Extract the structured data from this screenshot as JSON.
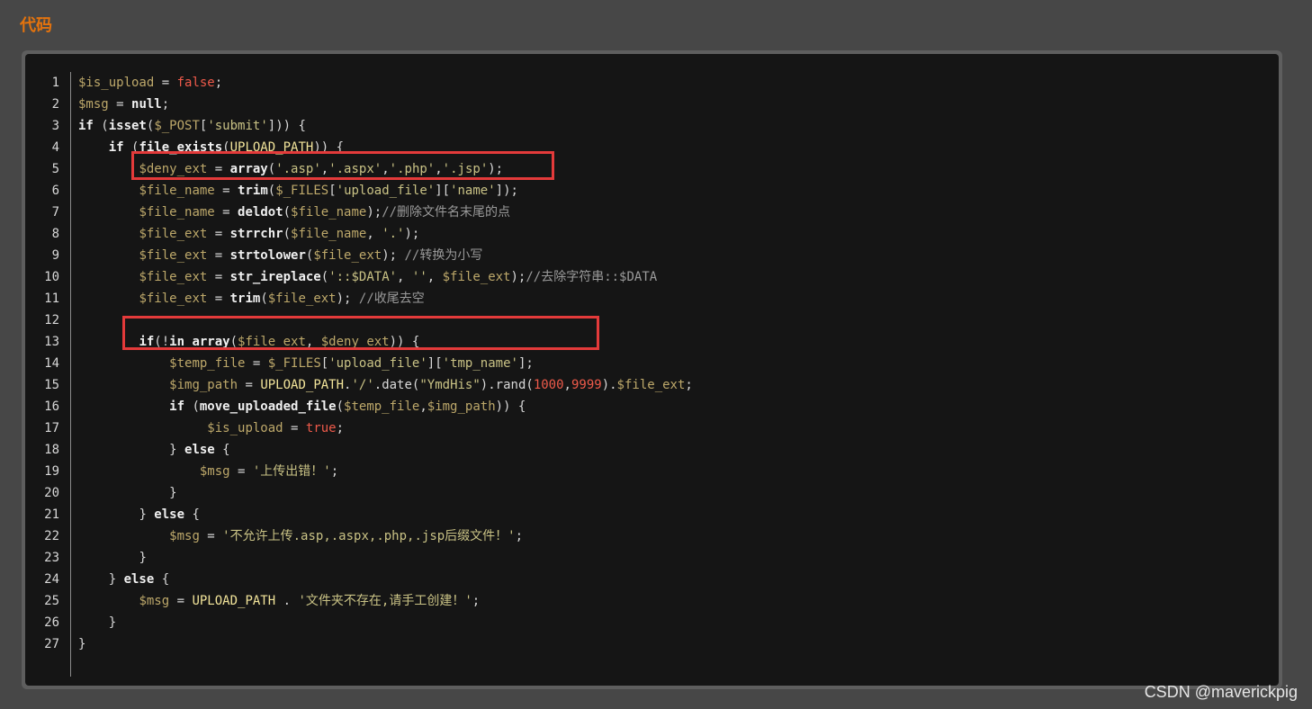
{
  "section_title": "代码",
  "watermark": "CSDN @maverickpig",
  "colors": {
    "page_bg": "#474747",
    "code_bg": "#151515",
    "title": "#e4730d",
    "highlight_box": "#e33a3a"
  },
  "code": {
    "language": "php",
    "line_numbers": [
      "1",
      "2",
      "3",
      "4",
      "5",
      "6",
      "7",
      "8",
      "9",
      "10",
      "11",
      "12",
      "13",
      "14",
      "15",
      "16",
      "17",
      "18",
      "19",
      "20",
      "21",
      "22",
      "23",
      "24",
      "25",
      "26",
      "27"
    ],
    "tokens": {
      "l1": [
        "$is_upload",
        " = ",
        "false",
        ";"
      ],
      "l2": [
        "$msg",
        " = ",
        "null",
        ";"
      ],
      "l3": [
        "if",
        " (",
        "isset",
        "(",
        "$_POST",
        "[",
        "'submit'",
        "])) {"
      ],
      "l4": [
        "    ",
        "if",
        " (",
        "file_exists",
        "(",
        "UPLOAD_PATH",
        ")) {"
      ],
      "l5": [
        "        ",
        "$deny_ext",
        " = ",
        "array",
        "(",
        "'.asp'",
        ",",
        "'.aspx'",
        ",",
        "'.php'",
        ",",
        "'.jsp'",
        ");"
      ],
      "l6": [
        "        ",
        "$file_name",
        " = ",
        "trim",
        "(",
        "$_FILES",
        "[",
        "'upload_file'",
        "][",
        "'name'",
        "]);"
      ],
      "l7": [
        "        ",
        "$file_name",
        " = ",
        "deldot",
        "(",
        "$file_name",
        ");",
        "//删除文件名末尾的点"
      ],
      "l8": [
        "        ",
        "$file_ext",
        " = ",
        "strrchr",
        "(",
        "$file_name",
        ", ",
        "'.'",
        ");"
      ],
      "l9": [
        "        ",
        "$file_ext",
        " = ",
        "strtolower",
        "(",
        "$file_ext",
        "); ",
        "//转换为小写"
      ],
      "l10": [
        "        ",
        "$file_ext",
        " = ",
        "str_ireplace",
        "(",
        "'::$DATA'",
        ", ",
        "''",
        ", ",
        "$file_ext",
        ");",
        "//去除字符串::$DATA"
      ],
      "l11": [
        "        ",
        "$file_ext",
        " = ",
        "trim",
        "(",
        "$file_ext",
        "); ",
        "//收尾去空"
      ],
      "l12": [
        ""
      ],
      "l13": [
        "        ",
        "if",
        "(!",
        "in_array",
        "(",
        "$file_ext",
        ", ",
        "$deny_ext",
        ")) {"
      ],
      "l14": [
        "            ",
        "$temp_file",
        " = ",
        "$_FILES",
        "[",
        "'upload_file'",
        "][",
        "'tmp_name'",
        "];"
      ],
      "l15": [
        "            ",
        "$img_path",
        " = ",
        "UPLOAD_PATH",
        ".",
        "'/'",
        ".",
        "date",
        "(",
        "\"YmdHis\"",
        ").",
        "rand",
        "(",
        "1000",
        ",",
        "9999",
        ").",
        "$file_ext",
        ";"
      ],
      "l16": [
        "            ",
        "if",
        " (",
        "move_uploaded_file",
        "(",
        "$temp_file",
        ",",
        "$img_path",
        ")) {"
      ],
      "l17": [
        "                 ",
        "$is_upload",
        " = ",
        "true",
        ";"
      ],
      "l18": [
        "            ",
        "} ",
        "else",
        " {"
      ],
      "l19": [
        "                ",
        "$msg",
        " = ",
        "'上传出错！'",
        ";"
      ],
      "l20": [
        "            ",
        "}"
      ],
      "l21": [
        "        ",
        "} ",
        "else",
        " {"
      ],
      "l22": [
        "            ",
        "$msg",
        " = ",
        "'不允许上传.asp,.aspx,.php,.jsp后缀文件！'",
        ";"
      ],
      "l23": [
        "        ",
        "}"
      ],
      "l24": [
        "    ",
        "} ",
        "else",
        " {"
      ],
      "l25": [
        "        ",
        "$msg",
        " = ",
        "UPLOAD_PATH",
        " . ",
        "'文件夹不存在,请手工创建！'",
        ";"
      ],
      "l26": [
        "    ",
        "}"
      ],
      "l27": [
        "}"
      ]
    }
  }
}
